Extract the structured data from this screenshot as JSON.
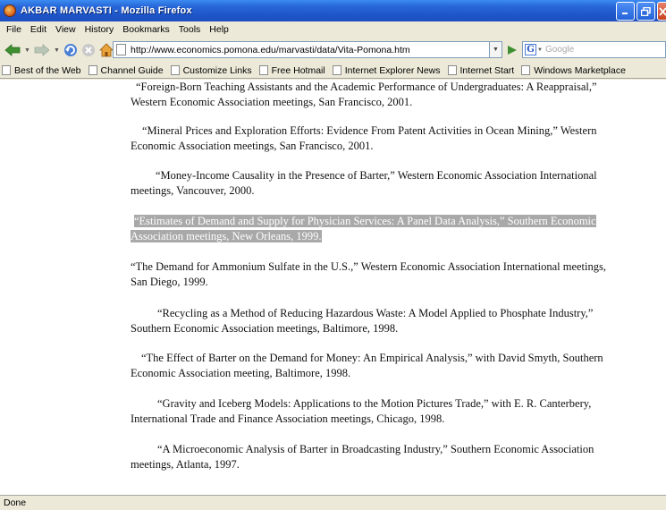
{
  "window": {
    "title": "AKBAR MARVASTI - Mozilla Firefox"
  },
  "menu": [
    {
      "label": "File"
    },
    {
      "label": "Edit"
    },
    {
      "label": "View"
    },
    {
      "label": "History"
    },
    {
      "label": "Bookmarks"
    },
    {
      "label": "Tools"
    },
    {
      "label": "Help"
    }
  ],
  "navbar": {
    "url": "http://www.economics.pomona.edu/marvasti/data/Vita-Pomona.htm",
    "search_placeholder": "Google",
    "icons": [
      "back-icon",
      "forward-icon",
      "reload-icon",
      "stop-icon",
      "home-icon",
      "go-icon",
      "google-icon"
    ]
  },
  "bookmarks": [
    {
      "label": "Best of the Web"
    },
    {
      "label": "Channel Guide"
    },
    {
      "label": "Customize Links"
    },
    {
      "label": "Free Hotmail"
    },
    {
      "label": "Internet Explorer News"
    },
    {
      "label": "Internet Start"
    },
    {
      "label": "Windows Marketplace"
    }
  ],
  "content": {
    "entries": [
      {
        "first": "“Foreign-Born Teaching Assistants and the Academic Performance of Undergraduates: A Reappraisal,”",
        "rest": "Western Economic Association meetings, San Francisco, 2001."
      },
      {
        "first": "“Mineral Prices and Exploration Efforts: Evidence From Patent Activities in Ocean Mining,” Western",
        "rest": "Economic Association meetings, San Francisco, 2001."
      },
      {
        "first": "“Money-Income Causality in the Presence of Barter,” Western Economic Association International",
        "rest": "meetings, Vancouver, 2000."
      },
      {
        "first": "“Estimates of Demand and Supply for Physician Services: A Panel Data Analysis,” Southern Economic",
        "rest": "Association meetings, New Orleans, 1999."
      },
      {
        "first": "“The Demand for Ammonium Sulfate in the U.S.,” Western Economic Association International meetings,",
        "rest": "San Diego, 1999."
      },
      {
        "first": "“Recycling as a Method of Reducing Hazardous Waste: A Model Applied to Phosphate Industry,”",
        "rest": "Southern Economic Association meetings, Baltimore, 1998."
      },
      {
        "first": "“The Effect of Barter on the Demand for Money: An Empirical Analysis,” with David Smyth, Southern",
        "rest": "Economic Association meeting, Baltimore, 1998."
      },
      {
        "first": "“Gravity and Iceberg Models: Applications to the Motion Pictures Trade,” with E. R. Canterbery,",
        "rest": "International Trade and Finance Association meetings, Chicago, 1998."
      },
      {
        "first": "“A Microeconomic Analysis of Barter in Broadcasting Industry,” Southern Economic Association",
        "rest": "meetings, Atlanta, 1997."
      }
    ]
  },
  "status": {
    "text": "Done"
  }
}
